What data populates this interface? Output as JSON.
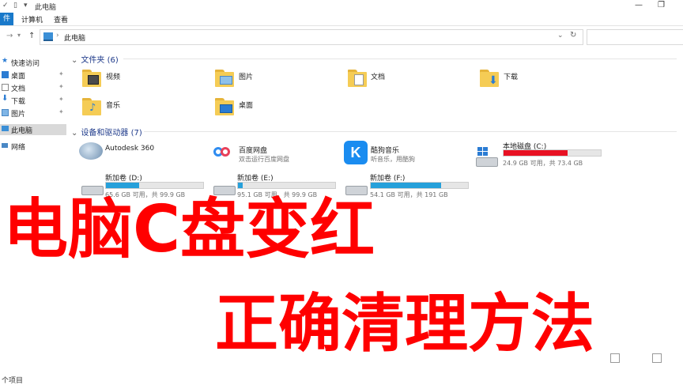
{
  "window": {
    "title": "此电脑"
  },
  "ribbon": {
    "file_tab": "件",
    "tabs": [
      "计算机",
      "查看"
    ]
  },
  "address": {
    "path": "此电脑"
  },
  "nav": {
    "quick_access": "快速访问",
    "pinned": [
      "桌面",
      "文档",
      "下载",
      "图片"
    ],
    "this_pc": "此电脑",
    "network": "网络"
  },
  "folders_section": {
    "title": "文件夹 (6)"
  },
  "folders": [
    "视频",
    "图片",
    "文档",
    "下载",
    "音乐",
    "桌面"
  ],
  "devices_section": {
    "title": "设备和驱动器 (7)"
  },
  "apps": [
    {
      "name": "Autodesk 360",
      "sub": ""
    },
    {
      "name": "百度网盘",
      "sub": "双击运行百度网盘"
    },
    {
      "name": "酷狗音乐",
      "sub": "听音乐，用酷狗"
    }
  ],
  "drives": [
    {
      "name": "本地磁盘 (C:)",
      "free": "24.9 GB 可用，共 73.4 GB",
      "used_fraction": 0.66,
      "color": "#e81123"
    },
    {
      "name": "新加卷 (D:)",
      "free": "65.6 GB 可用，共 99.9 GB",
      "used_fraction": 0.34,
      "color": "#26a0da"
    },
    {
      "name": "新加卷 (E:)",
      "free": "95.1 GB 可用，共 99.9 GB",
      "used_fraction": 0.05,
      "color": "#26a0da"
    },
    {
      "name": "新加卷 (F:)",
      "free": "54.1 GB 可用，共 191 GB",
      "used_fraction": 0.72,
      "color": "#26a0da"
    }
  ],
  "status": {
    "count": "个项目"
  },
  "overlay": {
    "line1": "电脑C盘变红",
    "line2": "正确清理方法"
  }
}
